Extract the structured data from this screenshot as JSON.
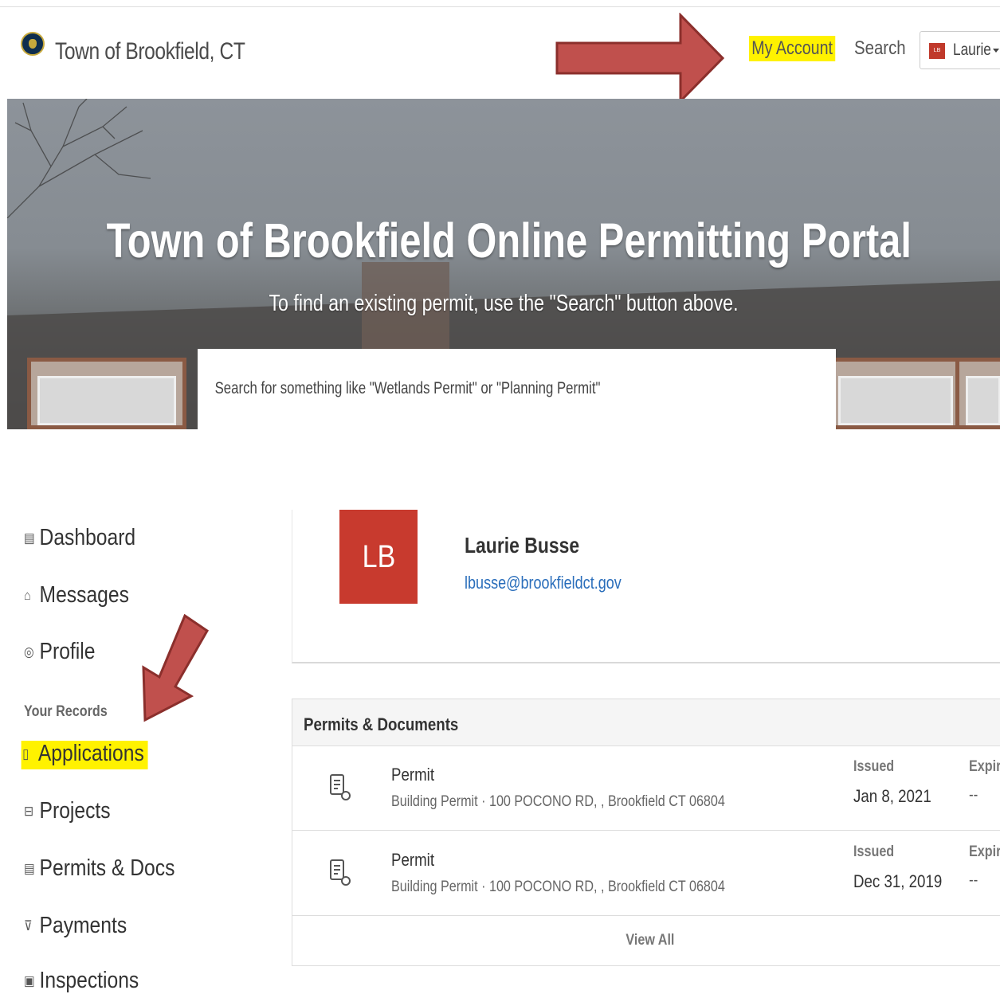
{
  "navbar": {
    "brand": "Town of Brookfield, CT",
    "my_account": "My Account",
    "search": "Search",
    "user_initials": "LB",
    "user_name": "Laurie"
  },
  "hero": {
    "title": "Town of Brookfield Online Permitting Portal",
    "subtitle": "To find an existing permit, use the \"Search\" button above.",
    "search_placeholder": "Search for something like \"Wetlands Permit\" or \"Planning Permit\""
  },
  "sidebar": {
    "items": [
      {
        "icon": "dashboard-icon",
        "glyph": "▤",
        "label": "Dashboard"
      },
      {
        "icon": "messages-icon",
        "glyph": "⌂",
        "label": "Messages"
      },
      {
        "icon": "profile-icon",
        "glyph": "◎",
        "label": "Profile"
      }
    ],
    "records_label": "Your Records",
    "records": [
      {
        "icon": "applications-icon",
        "glyph": "▯",
        "label": "Applications",
        "highlighted": true
      },
      {
        "icon": "projects-icon",
        "glyph": "⊟",
        "label": "Projects"
      },
      {
        "icon": "permits-docs-icon",
        "glyph": "▤",
        "label": "Permits & Docs"
      },
      {
        "icon": "payments-icon",
        "glyph": "⊽",
        "label": "Payments"
      },
      {
        "icon": "inspections-icon",
        "glyph": "▣",
        "label": "Inspections"
      }
    ]
  },
  "profile": {
    "initials": "LB",
    "name": "Laurie Busse",
    "email": "lbusse@brookfieldct.gov"
  },
  "permits_panel": {
    "title": "Permits & Documents",
    "rows": [
      {
        "type": "Permit",
        "description": "Building Permit · 100 POCONO RD, , Brookfield CT 06804",
        "issued_label": "Issued",
        "issued": "Jan 8, 2021",
        "expires_label": "Expir",
        "expires": "--"
      },
      {
        "type": "Permit",
        "description": "Building Permit · 100 POCONO RD, , Brookfield CT 06804",
        "issued_label": "Issued",
        "issued": "Dec 31, 2019",
        "expires_label": "Expir",
        "expires": "--"
      }
    ],
    "view_all": "View All"
  },
  "colors": {
    "highlight": "#fff200",
    "avatar_red": "#c83a2e",
    "link_blue": "#2a6ebb",
    "arrow_red": "#c0504d"
  }
}
